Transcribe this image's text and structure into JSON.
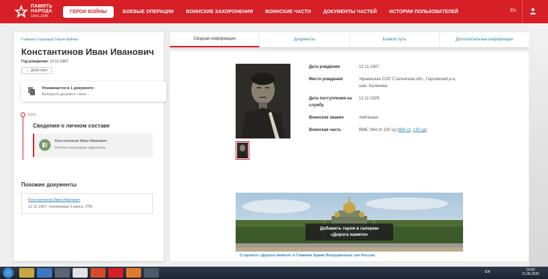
{
  "header": {
    "logo_line1": "ПАМЯТЬ",
    "logo_line2": "НАРОДА",
    "logo_years": "1941-1945",
    "nav": [
      {
        "label": "ГЕРОИ ВОЙНЫ",
        "active": true
      },
      {
        "label": "БОЕВЫЕ ОПЕРАЦИИ"
      },
      {
        "label": "ВОИНСКИЕ ЗАХОРОНЕНИЯ"
      },
      {
        "label": "ВОИНСКИЕ ЧАСТИ"
      },
      {
        "label": "ДОКУМЕНТЫ ЧАСТЕЙ"
      },
      {
        "label": "ИСТОРИИ ПОЛЬЗОВАТЕЛЕЙ"
      }
    ],
    "lang": "En",
    "brand_color": "#d61f26"
  },
  "breadcrumb": {
    "home": "Главная страница",
    "section": "Герои войны"
  },
  "person": {
    "name": "Константинов Иван Иванович",
    "birth_label": "Год рождения:",
    "birth_value": "12.11.1907",
    "actions_label": "⋮ Действия"
  },
  "mention": {
    "title": "Упоминается в 1 документе:",
    "subtitle": "Выберите документ ниже ↓"
  },
  "timeline": {
    "year": "1929",
    "heading": "Сведения о личном составе",
    "record_name": "Константинов Иван Иванович",
    "record_type": "Учетно-послужная картотека"
  },
  "similar": {
    "heading": "Похожие документы",
    "items": [
      {
        "link": "Константинов Иван Иванович",
        "desc": "12.11.1907, техникомер 2 ранга, УПК"
      }
    ]
  },
  "tabs": [
    {
      "label": "Сводная информация",
      "active": true
    },
    {
      "label": "Документы"
    },
    {
      "label": "Боевой путь"
    },
    {
      "label": "Дополнительная информация"
    }
  ],
  "info": {
    "rows": [
      {
        "label": "Дата рождения",
        "value": "12.11.1907"
      },
      {
        "label": "Место рождения",
        "value": "Украинская ССР, Сталинская обл., Горловский р-н, шах. Калинина"
      },
      {
        "label": "Дата поступления на службу",
        "value": "12.11.1929"
      },
      {
        "label": "Воинское звание",
        "value": "лейтенант"
      }
    ],
    "unit_label": "Воинская часть",
    "unit_prefix": "ВМБ; 664 сп 130 сд (",
    "unit_link1": "664 сп",
    "unit_sep": ", ",
    "unit_link2": "130 сд",
    "unit_suffix": ")"
  },
  "banner": {
    "cta_line1": "Добавить героя в галерею",
    "cta_line2": "«Дорога памяти»",
    "caption": "О проекте «Дорога памяти» в Главном Храме Вооруженных сил России"
  },
  "taskbar": {
    "lang": "EN",
    "time": "14:02",
    "date": "21.06.2020"
  }
}
